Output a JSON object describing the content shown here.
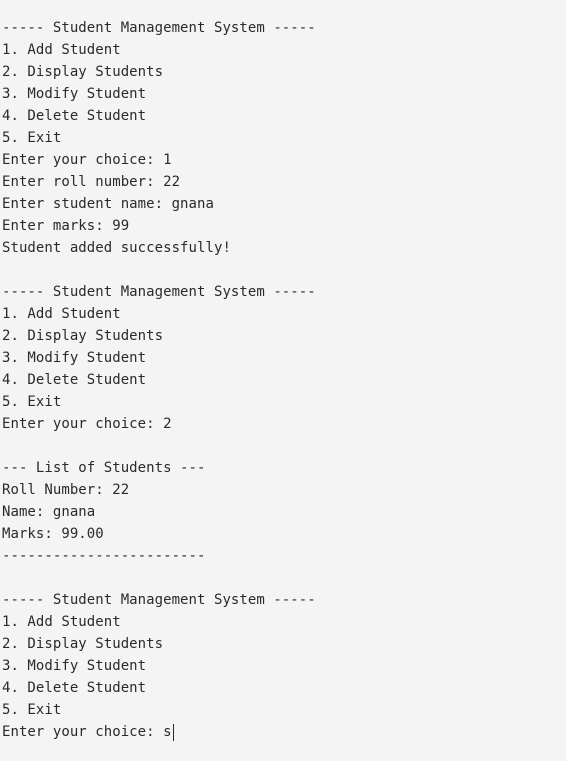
{
  "session": {
    "block1": {
      "header": "----- Student Management System -----",
      "menu": [
        "1. Add Student",
        "2. Display Students",
        "3. Modify Student",
        "4. Delete Student",
        "5. Exit"
      ],
      "choice": "Enter your choice: 1",
      "roll": "Enter roll number: 22",
      "name": "Enter student name: gnana",
      "marks": "Enter marks: 99",
      "result": "Student added successfully!"
    },
    "block2": {
      "header": "----- Student Management System -----",
      "menu": [
        "1. Add Student",
        "2. Display Students",
        "3. Modify Student",
        "4. Delete Student",
        "5. Exit"
      ],
      "choice": "Enter your choice: 2"
    },
    "list": {
      "header": "--- List of Students ---",
      "roll": "Roll Number: 22",
      "name": "Name: gnana",
      "marks": "Marks: 99.00",
      "divider": "------------------------"
    },
    "block3": {
      "header": "----- Student Management System -----",
      "menu": [
        "1. Add Student",
        "2. Display Students",
        "3. Modify Student",
        "4. Delete Student",
        "5. Exit"
      ],
      "prompt": "Enter your choice: ",
      "input_value": "s"
    }
  }
}
